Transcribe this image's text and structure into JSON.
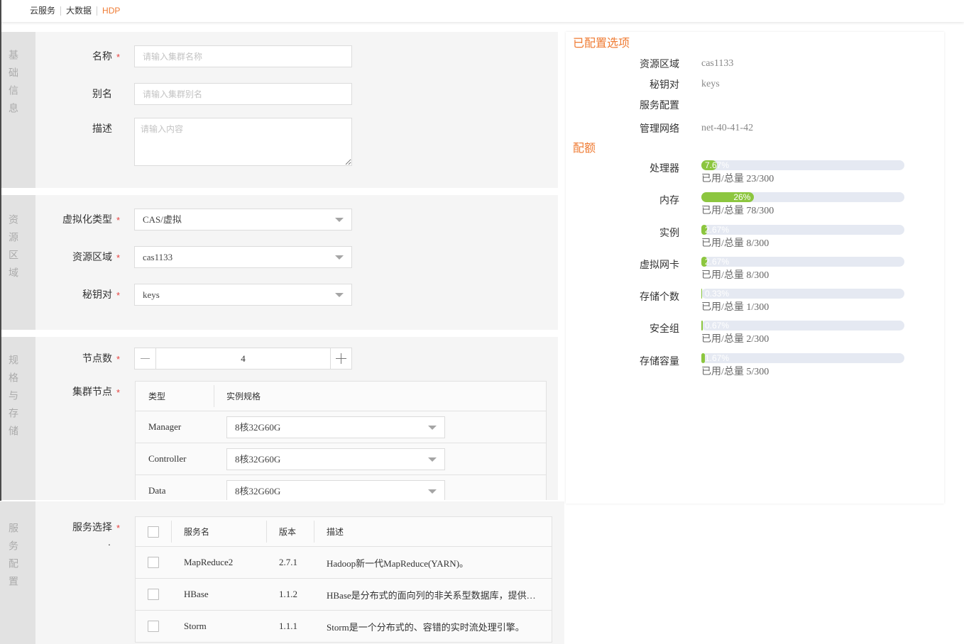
{
  "breadcrumb": {
    "items": [
      "云服务",
      "大数据"
    ],
    "current": "HDP"
  },
  "colors": {
    "accent": "#ef7b33",
    "required": "#e64340",
    "progress_fill": "#8cc63f",
    "progress_track": "#e5e9f2"
  },
  "form": {
    "required_mark": "*",
    "basic": {
      "section_title": "基础信息",
      "name": {
        "label": "名称",
        "placeholder": "请输入集群名称"
      },
      "alias": {
        "label": "别名",
        "placeholder": "请输入集群别名"
      },
      "description": {
        "label": "描述",
        "placeholder": "请输入内容"
      }
    },
    "resource": {
      "section_title": "资源区域",
      "virtualization_type": {
        "label": "虚拟化类型",
        "value": "CAS/虚拟"
      },
      "region": {
        "label": "资源区域",
        "value": "cas1133"
      },
      "keypair": {
        "label": "秘钥对",
        "value": "keys"
      }
    },
    "spec": {
      "section_title": "规格与存储",
      "node_count": {
        "label": "节点数",
        "value": "4"
      },
      "cluster_nodes": {
        "label": "集群节点",
        "columns": [
          "类型",
          "实例规格"
        ],
        "rows": [
          {
            "type": "Manager",
            "spec": "8核32G60G"
          },
          {
            "type": "Controller",
            "spec": "8核32G60G"
          },
          {
            "type": "Data",
            "spec": "8核32G60G"
          }
        ]
      }
    },
    "service": {
      "section_title": "服务配置",
      "label": "服务选择",
      "note": ".",
      "columns": [
        "服务名",
        "版本",
        "描述"
      ],
      "select_all": false,
      "rows": [
        {
          "name": "MapReduce2",
          "version": "2.7.1",
          "description": "Hadoop新一代MapReduce(YARN)。",
          "checked": false
        },
        {
          "name": "HBase",
          "version": "1.1.2",
          "description": "HBase是分布式的面向列的非关系型数据库，提供…",
          "checked": false
        },
        {
          "name": "Storm",
          "version": "1.1.1",
          "description": "Storm是一个分布式的、容错的实时流处理引擎。",
          "checked": false
        }
      ]
    }
  },
  "summary": {
    "configured_title": "已配置选项",
    "items": [
      {
        "label": "资源区域",
        "value": "cas1133"
      },
      {
        "label": "秘钥对",
        "value": "keys"
      },
      {
        "label": "服务配置",
        "value": ""
      },
      {
        "label": "管理网络",
        "value": "net-40-41-42"
      }
    ],
    "quota_title": "配额",
    "quotas": [
      {
        "label": "处理器",
        "percent": 7.67,
        "percent_text": "7.67%",
        "usage": "已用/总量 23/300"
      },
      {
        "label": "内存",
        "percent": 26,
        "percent_text": "26%",
        "usage": "已用/总量 78/300"
      },
      {
        "label": "实例",
        "percent": 2.67,
        "percent_text": "2.67%",
        "usage": "已用/总量 8/300"
      },
      {
        "label": "虚拟网卡",
        "percent": 2.67,
        "percent_text": "2.67%",
        "usage": "已用/总量 8/300"
      },
      {
        "label": "存储个数",
        "percent": 0.33,
        "percent_text": "0.33%",
        "usage": "已用/总量 1/300"
      },
      {
        "label": "安全组",
        "percent": 0.67,
        "percent_text": "0.67%",
        "usage": "已用/总量 2/300"
      },
      {
        "label": "存储容量",
        "percent": 1.67,
        "percent_text": "1.67%",
        "usage": "已用/总量 5/300"
      }
    ]
  }
}
